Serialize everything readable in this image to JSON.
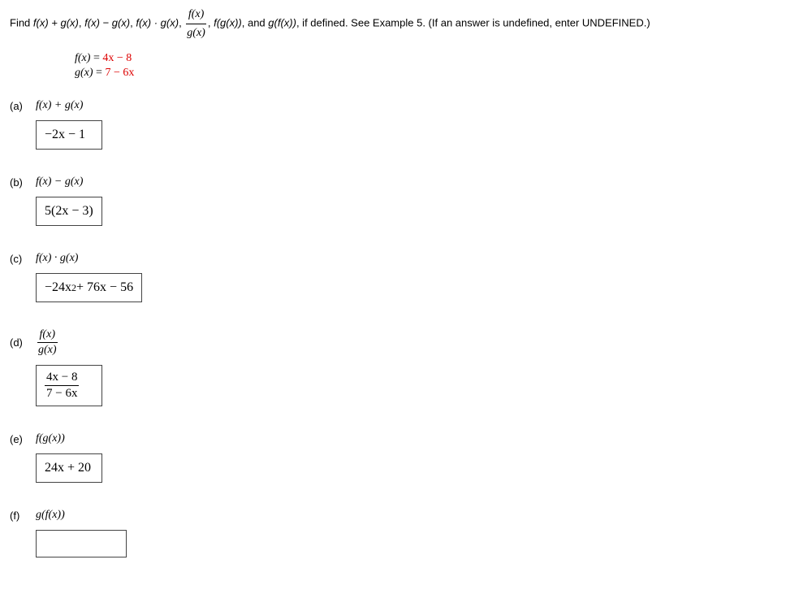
{
  "instruction": {
    "prefix": "Find ",
    "e1": "f(x) + g(x)",
    "e2": "f(x) − g(x)",
    "e3": "f(x) · g(x)",
    "frac_num": "f(x)",
    "frac_den": "g(x)",
    "e5": "f(g(x))",
    "e6_prefix": ", and ",
    "e6": "g(f(x))",
    "suffix": ", if defined. See Example 5. (If an answer is undefined, enter UNDEFINED.)",
    "comma": ", "
  },
  "given": {
    "f_lhs": "f(x)",
    "f_eq": " = ",
    "f_val": "4x − 8",
    "g_lhs": "g(x)",
    "g_eq": " = ",
    "g_val": "7 − 6x"
  },
  "parts": {
    "a": {
      "label": "(a)",
      "expr": "f(x) + g(x)",
      "answer": "−2x − 1"
    },
    "b": {
      "label": "(b)",
      "expr": "f(x) − g(x)",
      "answer": "5(2x − 3)"
    },
    "c": {
      "label": "(c)",
      "expr": "f(x) · g(x)",
      "answer_pre": "−24x",
      "answer_sup": "2",
      "answer_post": " + 76x − 56"
    },
    "d": {
      "label": "(d)",
      "expr_num": "f(x)",
      "expr_den": "g(x)",
      "answer_num": "4x − 8",
      "answer_den": "7 − 6x"
    },
    "e": {
      "label": "(e)",
      "expr": "f(g(x))",
      "answer": "24x + 20"
    },
    "f": {
      "label": "(f)",
      "expr": "g(f(x))",
      "answer": ""
    }
  }
}
